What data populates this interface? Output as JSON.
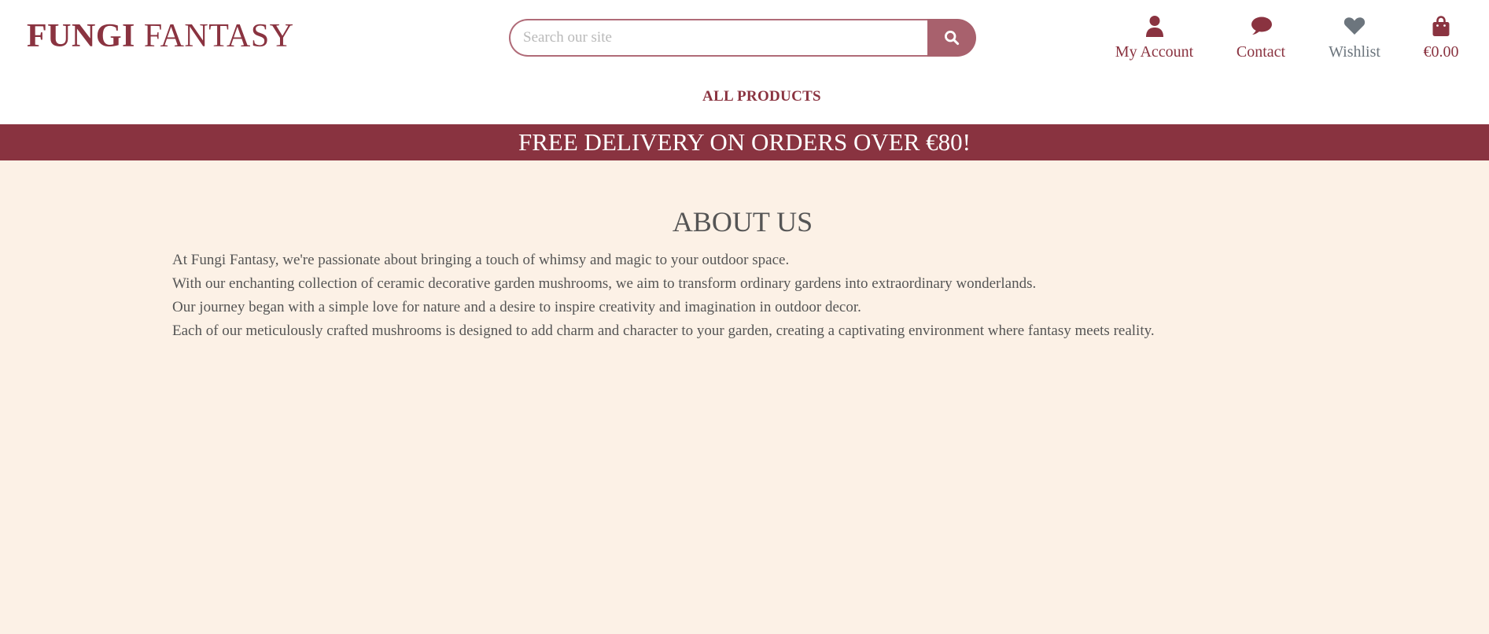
{
  "brand": {
    "name_bold": "FUNGI",
    "name_regular": "FANTASY"
  },
  "search": {
    "placeholder": "Search our site",
    "value": "",
    "button_icon": "search-icon"
  },
  "header_nav": {
    "account": {
      "label": "My Account",
      "icon": "user-icon"
    },
    "contact": {
      "label": "Contact",
      "icon": "comment-icon"
    },
    "wishlist": {
      "label": "Wishlist",
      "icon": "heart-icon"
    },
    "cart": {
      "label": "€0.00",
      "icon": "shopping-bag-icon"
    }
  },
  "main_nav": {
    "items": [
      {
        "label": "ALL PRODUCTS"
      }
    ]
  },
  "banner": {
    "text": "FREE DELIVERY ON ORDERS OVER €80!"
  },
  "about": {
    "title": "ABOUT US",
    "paragraphs": [
      "At Fungi Fantasy, we're passionate about bringing a touch of whimsy and magic to your outdoor space.",
      "With our enchanting collection of ceramic decorative garden mushrooms, we aim to transform ordinary gardens into extraordinary wonderlands.",
      "Our journey began with a simple love for nature and a desire to inspire creativity and imagination in outdoor decor.",
      "Each of our meticulously crafted mushrooms is designed to add charm and character to your garden, creating a captivating environment where fantasy meets reality."
    ]
  },
  "colors": {
    "brand": "#8a3340",
    "banner_bg": "#893340",
    "search_button": "#a8616d",
    "page_bg": "#fcf1e6",
    "body_text": "#555555",
    "wishlist_icon": "#6c757d"
  }
}
